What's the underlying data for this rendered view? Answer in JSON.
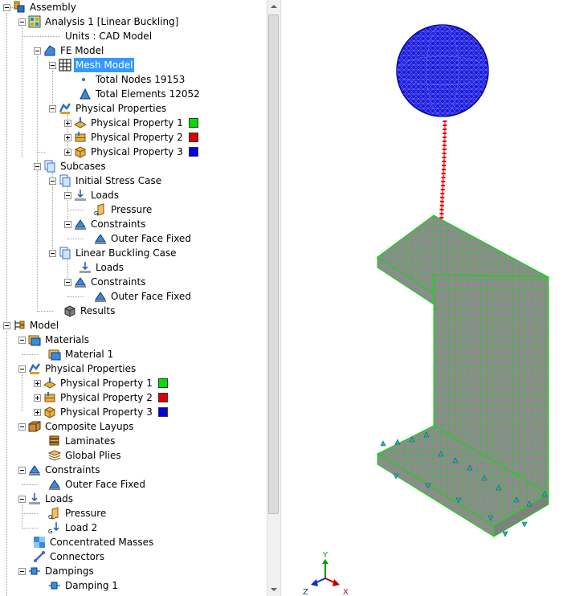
{
  "tree": {
    "assembly": "Assembly",
    "analysis": "Analysis 1 [Linear Buckling]",
    "units": "Units : CAD Model",
    "fe_model": "FE Model",
    "mesh_model": "Mesh Model",
    "total_nodes": "Total Nodes 19153",
    "total_elements": "Total Elements 12052",
    "physical_properties": "Physical Properties",
    "pp1": "Physical Property 1",
    "pp2": "Physical Property 2",
    "pp3": "Physical Property 3",
    "subcases": "Subcases",
    "initial_stress_case": "Initial Stress Case",
    "loads": "Loads",
    "pressure": "Pressure",
    "constraints": "Constraints",
    "outer_face_fixed": "Outer Face Fixed",
    "linear_buckling_case": "Linear Buckling Case",
    "results": "Results",
    "model": "Model",
    "materials": "Materials",
    "material1": "Material 1",
    "composite_layups": "Composite Layups",
    "laminates": "Laminates",
    "global_plies": "Global Plies",
    "load2": "Load 2",
    "concentrated_masses": "Concentrated Masses",
    "connectors": "Connectors",
    "dampings": "Dampings",
    "damping1": "Damping 1"
  },
  "colors": {
    "pp1": "#00e000",
    "pp2": "#e00000",
    "pp3": "#0000e0",
    "selection": "#3399ff",
    "mesh_edge": "#00e000",
    "sphere": "#1010d0",
    "spring": "#e02020"
  },
  "triad": {
    "x": "X",
    "y": "Y",
    "z": "Z"
  }
}
